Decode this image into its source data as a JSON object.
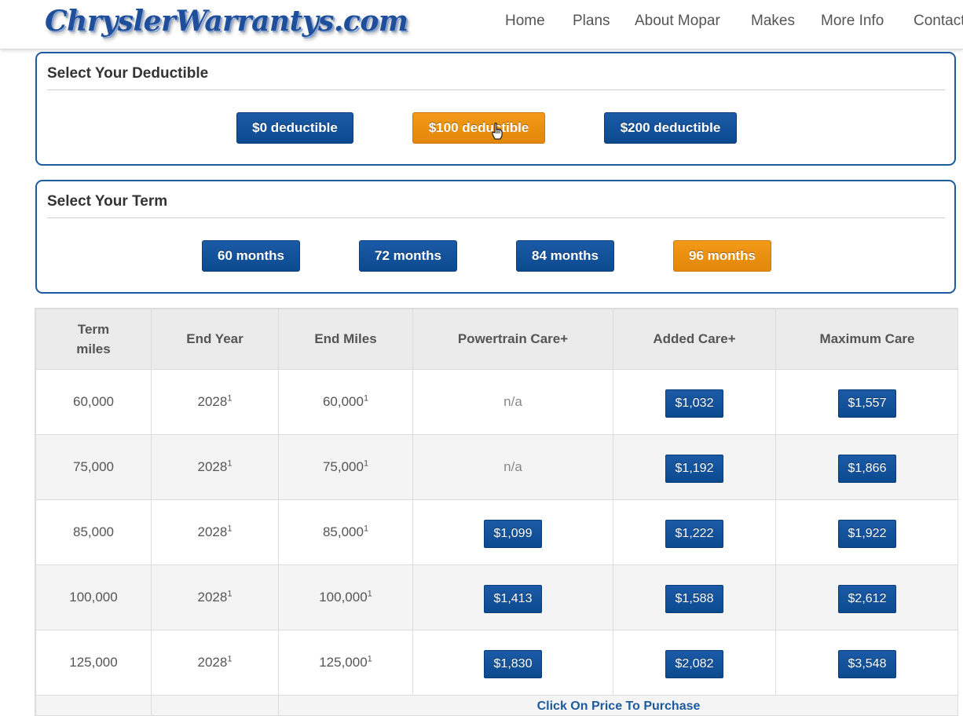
{
  "header": {
    "logo_text": "ChryslerWarrantys.com",
    "nav": [
      {
        "label": "Home"
      },
      {
        "label": "Plans"
      },
      {
        "label": "About Mopar"
      },
      {
        "label": "Makes"
      },
      {
        "label": "More Info"
      },
      {
        "label": "Contact"
      }
    ]
  },
  "deductible": {
    "title": "Select Your Deductible",
    "options": [
      {
        "label": "$0 deductible",
        "selected": false
      },
      {
        "label": "$100 deductible",
        "selected": true
      },
      {
        "label": "$200 deductible",
        "selected": false
      }
    ]
  },
  "term": {
    "title": "Select Your Term",
    "options": [
      {
        "label": "60 months",
        "selected": false
      },
      {
        "label": "72 months",
        "selected": false
      },
      {
        "label": "84 months",
        "selected": false
      },
      {
        "label": "96 months",
        "selected": true
      }
    ]
  },
  "table": {
    "headers": [
      "Term miles",
      "End Year",
      "End Miles",
      "Powertrain Care+",
      "Added Care+",
      "Maximum Care"
    ],
    "footnote_mark": "1",
    "rows": [
      {
        "miles": "60,000",
        "end_year": "2028",
        "end_miles": "60,000",
        "powertrain": "n/a",
        "added": "$1,032",
        "maximum": "$1,557"
      },
      {
        "miles": "75,000",
        "end_year": "2028",
        "end_miles": "75,000",
        "powertrain": "n/a",
        "added": "$1,192",
        "maximum": "$1,866"
      },
      {
        "miles": "85,000",
        "end_year": "2028",
        "end_miles": "85,000",
        "powertrain": "$1,099",
        "added": "$1,222",
        "maximum": "$1,922"
      },
      {
        "miles": "100,000",
        "end_year": "2028",
        "end_miles": "100,000",
        "powertrain": "$1,413",
        "added": "$1,588",
        "maximum": "$2,612"
      },
      {
        "miles": "125,000",
        "end_year": "2028",
        "end_miles": "125,000",
        "powertrain": "$1,830",
        "added": "$2,082",
        "maximum": "$3,548"
      }
    ],
    "footer_link": "Click On Price To Purchase"
  },
  "colors": {
    "brand_blue": "#0c4a8f",
    "selected_orange": "#e2870a",
    "panel_border": "#1d5a9e"
  }
}
